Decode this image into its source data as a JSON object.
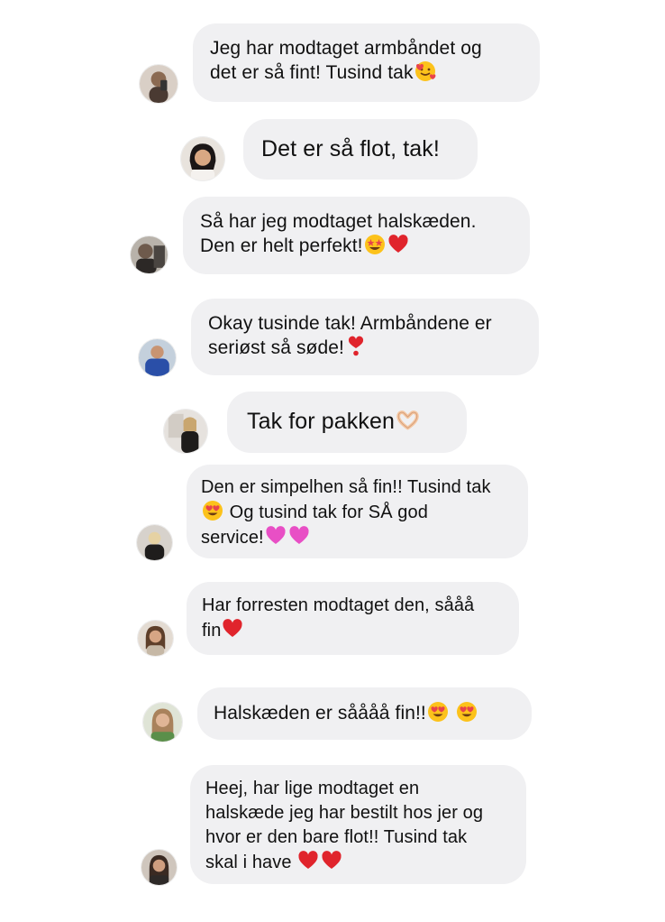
{
  "colors": {
    "bubble": "#f0f0f2",
    "text": "#111111"
  },
  "messages": [
    {
      "lines": [
        "Jeg har modtaget armbåndet og",
        "det er så fint! Tusind tak"
      ],
      "emoji": [
        [
          "",
          ""
        ],
        [
          "smiling-face-with-hearts-icon"
        ]
      ],
      "avatar": "avatar-1"
    },
    {
      "lines": [
        "Det er så flot, tak!"
      ],
      "emoji": [
        [
          ""
        ]
      ],
      "avatar": "avatar-2"
    },
    {
      "lines": [
        "Så har jeg modtaget halskæden.",
        "Den er helt perfekt!"
      ],
      "emoji": [
        [
          ""
        ],
        [
          "star-struck-icon",
          "red-heart-icon"
        ]
      ],
      "avatar": "avatar-3"
    },
    {
      "lines": [
        "Okay tusinde tak! Armbåndene er",
        "seriøst så søde!"
      ],
      "emoji": [
        [
          ""
        ],
        [
          "exclamation-heart-icon"
        ]
      ],
      "avatar": "avatar-4"
    },
    {
      "lines": [
        "Tak for pakken"
      ],
      "emoji": [
        [
          "heart-hands-icon"
        ]
      ],
      "avatar": "avatar-5"
    },
    {
      "lines": [
        "Den er simpelhen så fin!! Tusind tak",
        "Og tusind tak for SÅ god",
        "service!"
      ],
      "emoji": [
        [
          ""
        ],
        [
          "heart-eyes-icon"
        ],
        [
          "pink-heart-icon",
          "pink-heart-icon"
        ]
      ],
      "avatar": "avatar-6"
    },
    {
      "lines": [
        "Har forresten modtaget den, sååå",
        "fin"
      ],
      "emoji": [
        [
          ""
        ],
        [
          "red-heart-icon"
        ]
      ],
      "avatar": "avatar-7"
    },
    {
      "lines": [
        "Halskæden er såååå fin!!"
      ],
      "emoji": [
        [
          "heart-eyes-icon",
          "heart-eyes-icon"
        ]
      ],
      "avatar": "avatar-8"
    },
    {
      "lines": [
        "Heej, har lige modtaget en",
        "halskæde jeg har bestilt hos jer og",
        "hvor er den bare flot!! Tusind tak",
        "skal i have"
      ],
      "emoji": [
        [
          ""
        ],
        [
          ""
        ],
        [
          ""
        ],
        [
          "red-heart-icon",
          "red-heart-icon"
        ]
      ],
      "avatar": "avatar-9"
    }
  ]
}
